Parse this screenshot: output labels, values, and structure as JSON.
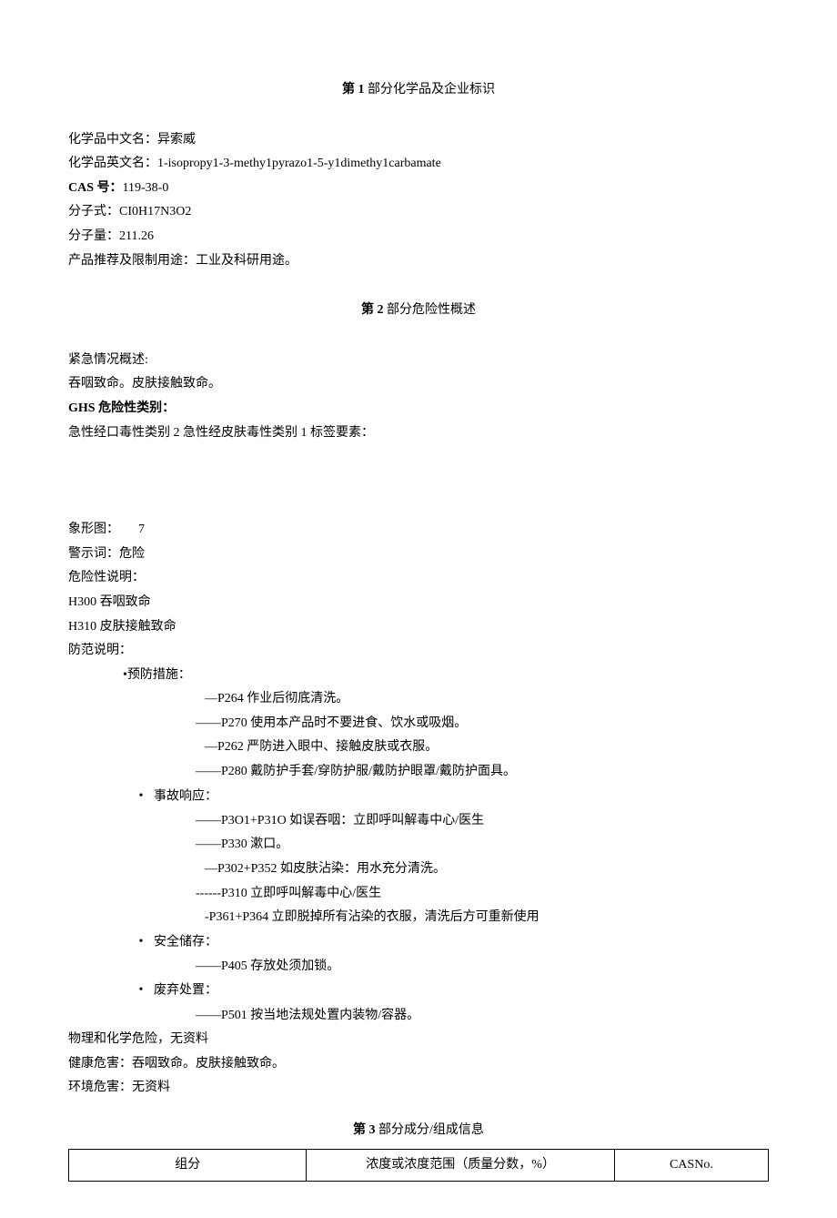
{
  "section1": {
    "title_prefix": "第 1 ",
    "title_rest": "部分化学品及企业标识",
    "name_cn_label": "化学品中文名：",
    "name_cn": "异索威",
    "name_en_label": "化学品英文名：",
    "name_en": "1-isopropy1-3-methy1pyrazo1-5-y1dimethy1carbamate",
    "cas_label": "CAS 号：",
    "cas": "119-38-0",
    "formula_label": "分子式：",
    "formula": "CI0H17N3O2",
    "mw_label": "分子量：",
    "mw": "211.26",
    "use_label": "产品推荐及限制用途：",
    "use": "工业及科研用途。"
  },
  "section2": {
    "title_prefix": "第 2 ",
    "title_rest": "部分危险性概述",
    "emergency_label": "紧急情况概述:",
    "emergency_text": "吞咽致命。皮肤接触致命。",
    "ghs_label": "GHS 危险性类别：",
    "ghs_text": "急性经口毒性类别 2 急性经皮肤毒性类别 1 标签要素：",
    "pictogram_label": "象形图：",
    "pictogram_value": "7",
    "signal_label": "警示词：",
    "signal": "危险",
    "hazard_stat_label": "危险性说明：",
    "h300": "H300 吞咽致命",
    "h310": "H310 皮肤接触致命",
    "precaution_label": "防范说明：",
    "prevention_header": "预防措施：",
    "p264": "—P264 作业后彻底清洗。",
    "p270": "——P270 使用本产品时不要进食、饮水或吸烟。",
    "p262": "—P262 严防进入眼中、接触皮肤或衣服。",
    "p280": "——P280 戴防护手套/穿防护服/戴防护眼罩/戴防护面具。",
    "response_header": "事故响应：",
    "p301": "——P3O1+P31O 如误吞咽：立即呼叫解毒中心/医生",
    "p330": "——P330 漱口。",
    "p302": "—P302+P352 如皮肤沾染：用水充分清洗。",
    "p310": "------P310 立即呼叫解毒中心/医生",
    "p361": "-P361+P364 立即脱掉所有沾染的衣服，清洗后方可重新使用",
    "storage_header": "安全储存：",
    "p405": "——P405 存放处须加锁。",
    "disposal_header": "废弃处置：",
    "p501": "——P501 按当地法规处置内装物/容器。",
    "phys_chem": "物理和化学危险，无资料",
    "health_label": "健康危害：",
    "health": "吞咽致命。皮肤接触致命。",
    "env_label": "环境危害：",
    "env": "无资料"
  },
  "section3": {
    "title_prefix": "第 3 ",
    "title_rest": "部分成分/组成信息",
    "col1": "组分",
    "col2": "浓度或浓度范围（质量分数，%）",
    "col3": "CASNo."
  }
}
